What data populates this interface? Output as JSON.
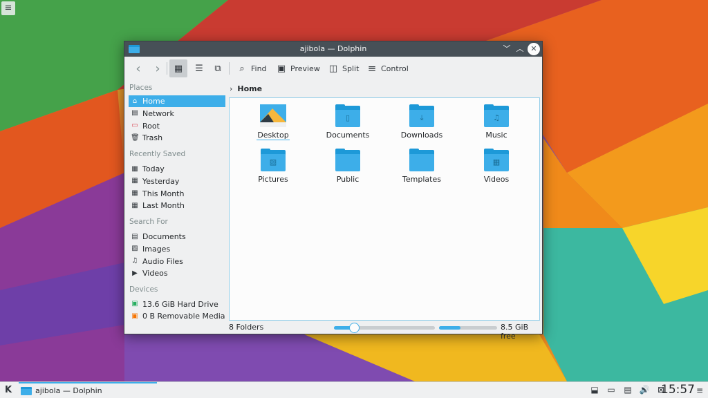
{
  "window": {
    "title": "ajibola — Dolphin",
    "controls": {
      "minimize": "﹀",
      "maximize": "︿",
      "close": "✕"
    }
  },
  "toolbar": {
    "back_icon": "‹",
    "forward_icon": "›",
    "icons_view_icon": "▦",
    "compact_view_icon": "☰",
    "details_view_icon": "⧉",
    "find": {
      "icon": "⌕",
      "label": "Find"
    },
    "preview": {
      "icon": "▣",
      "label": "Preview"
    },
    "split": {
      "icon": "◫",
      "label": "Split"
    },
    "control": {
      "icon": "≡",
      "label": "Control"
    }
  },
  "places": {
    "sections": [
      {
        "title": "Places",
        "items": [
          {
            "label": "Home",
            "icon": "⌂",
            "selected": true
          },
          {
            "label": "Network",
            "icon": "▤"
          },
          {
            "label": "Root",
            "icon": "▭"
          },
          {
            "label": "Trash",
            "icon": "🗑"
          }
        ]
      },
      {
        "title": "Recently Saved",
        "items": [
          {
            "label": "Today",
            "icon": "▦"
          },
          {
            "label": "Yesterday",
            "icon": "▦"
          },
          {
            "label": "This Month",
            "icon": "▦"
          },
          {
            "label": "Last Month",
            "icon": "▦"
          }
        ]
      },
      {
        "title": "Search For",
        "items": [
          {
            "label": "Documents",
            "icon": "▤"
          },
          {
            "label": "Images",
            "icon": "▨"
          },
          {
            "label": "Audio Files",
            "icon": "♫"
          },
          {
            "label": "Videos",
            "icon": "▶"
          }
        ]
      },
      {
        "title": "Devices",
        "items": [
          {
            "label": "13.6 GiB Hard Drive",
            "icon": "▣"
          },
          {
            "label": "0 B Removable Media",
            "icon": "▣"
          }
        ]
      }
    ]
  },
  "breadcrumb": {
    "chevron": "›",
    "current": "Home"
  },
  "files": [
    {
      "label": "Desktop",
      "emblem": ""
    },
    {
      "label": "Documents",
      "emblem": "▯"
    },
    {
      "label": "Downloads",
      "emblem": "⤓"
    },
    {
      "label": "Music",
      "emblem": "♫"
    },
    {
      "label": "Pictures",
      "emblem": "▨"
    },
    {
      "label": "Public",
      "emblem": ""
    },
    {
      "label": "Templates",
      "emblem": ""
    },
    {
      "label": "Videos",
      "emblem": "▦"
    }
  ],
  "status": {
    "folder_count": "8 Folders",
    "zoom_level": 0.2,
    "used_fraction": 0.37,
    "free_space": "8.5 GiB free"
  },
  "taskbar": {
    "launcher_icon": "K",
    "task_label": "ajibola — Dolphin",
    "tray_icons": [
      "⬓",
      "▭",
      "▤",
      "🔊",
      "⊠"
    ],
    "clock": "15:57",
    "panel_menu_icon": "≡"
  },
  "colors": {
    "accent": "#3daee9",
    "titlebar": "#475057",
    "window_bg": "#eff0f1"
  }
}
